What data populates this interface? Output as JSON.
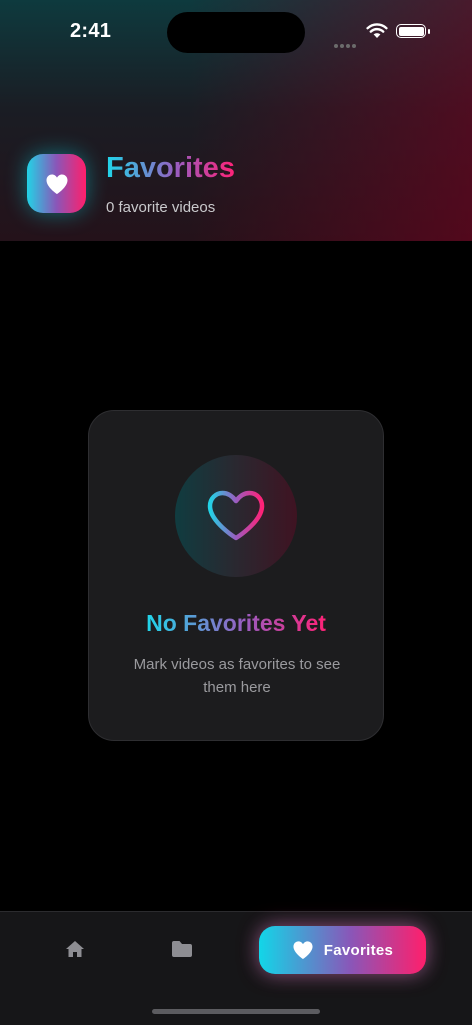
{
  "status_bar": {
    "time": "2:41"
  },
  "header": {
    "title": "Favorites",
    "subtitle": "0 favorite videos",
    "icon": "heart-icon"
  },
  "empty_state": {
    "icon": "heart-outline-icon",
    "title": "No Favorites Yet",
    "message": "Mark videos as favorites to see them here"
  },
  "tab_bar": {
    "items": [
      {
        "icon": "home-icon",
        "label": "",
        "active": false
      },
      {
        "icon": "folder-icon",
        "label": "",
        "active": false
      },
      {
        "icon": "heart-icon",
        "label": "Favorites",
        "active": true
      }
    ]
  },
  "colors": {
    "accent_cyan": "#22d3e6",
    "accent_pink": "#ff1f6b",
    "background": "#000000",
    "card": "#1c1c1e"
  }
}
